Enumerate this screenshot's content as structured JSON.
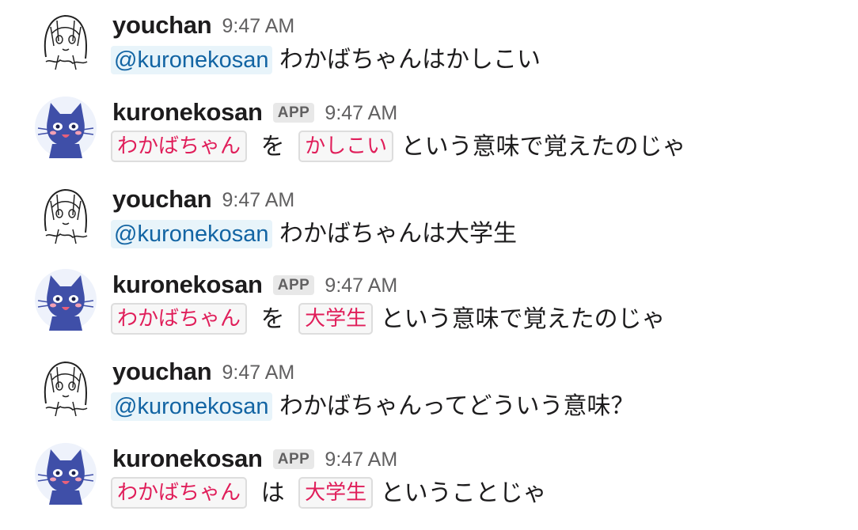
{
  "users": {
    "youchan": {
      "name": "youchan",
      "avatar_icon": "youchan-avatar-icon"
    },
    "kuronekosan": {
      "name": "kuronekosan",
      "avatar_icon": "cat-avatar-icon",
      "badge": "APP"
    }
  },
  "messages": [
    {
      "user": "youchan",
      "time": "9:47 AM",
      "mention": "@kuronekosan",
      "text": "わかばちゃんはかしこい"
    },
    {
      "user": "kuronekosan",
      "time": "9:47 AM",
      "badge": "APP",
      "code1": "わかばちゃん",
      "particle": "を",
      "code2": "かしこい",
      "text": "という意味で覚えたのじゃ"
    },
    {
      "user": "youchan",
      "time": "9:47 AM",
      "mention": "@kuronekosan",
      "text": "わかばちゃんは大学生"
    },
    {
      "user": "kuronekosan",
      "time": "9:47 AM",
      "badge": "APP",
      "code1": "わかばちゃん",
      "particle": "を",
      "code2": "大学生",
      "text": "という意味で覚えたのじゃ"
    },
    {
      "user": "youchan",
      "time": "9:47 AM",
      "mention": "@kuronekosan",
      "text": "わかばちゃんってどういう意味？"
    },
    {
      "user": "kuronekosan",
      "time": "9:47 AM",
      "badge": "APP",
      "code1": "わかばちゃん",
      "particle": "は",
      "code2": "大学生",
      "text": "ということじゃ"
    }
  ],
  "colors": {
    "mention_bg": "#e8f4fa",
    "mention_text": "#1264a3",
    "code_text": "#e01e5a",
    "code_border": "#dddddd",
    "cat_body": "#3f4fa8"
  }
}
